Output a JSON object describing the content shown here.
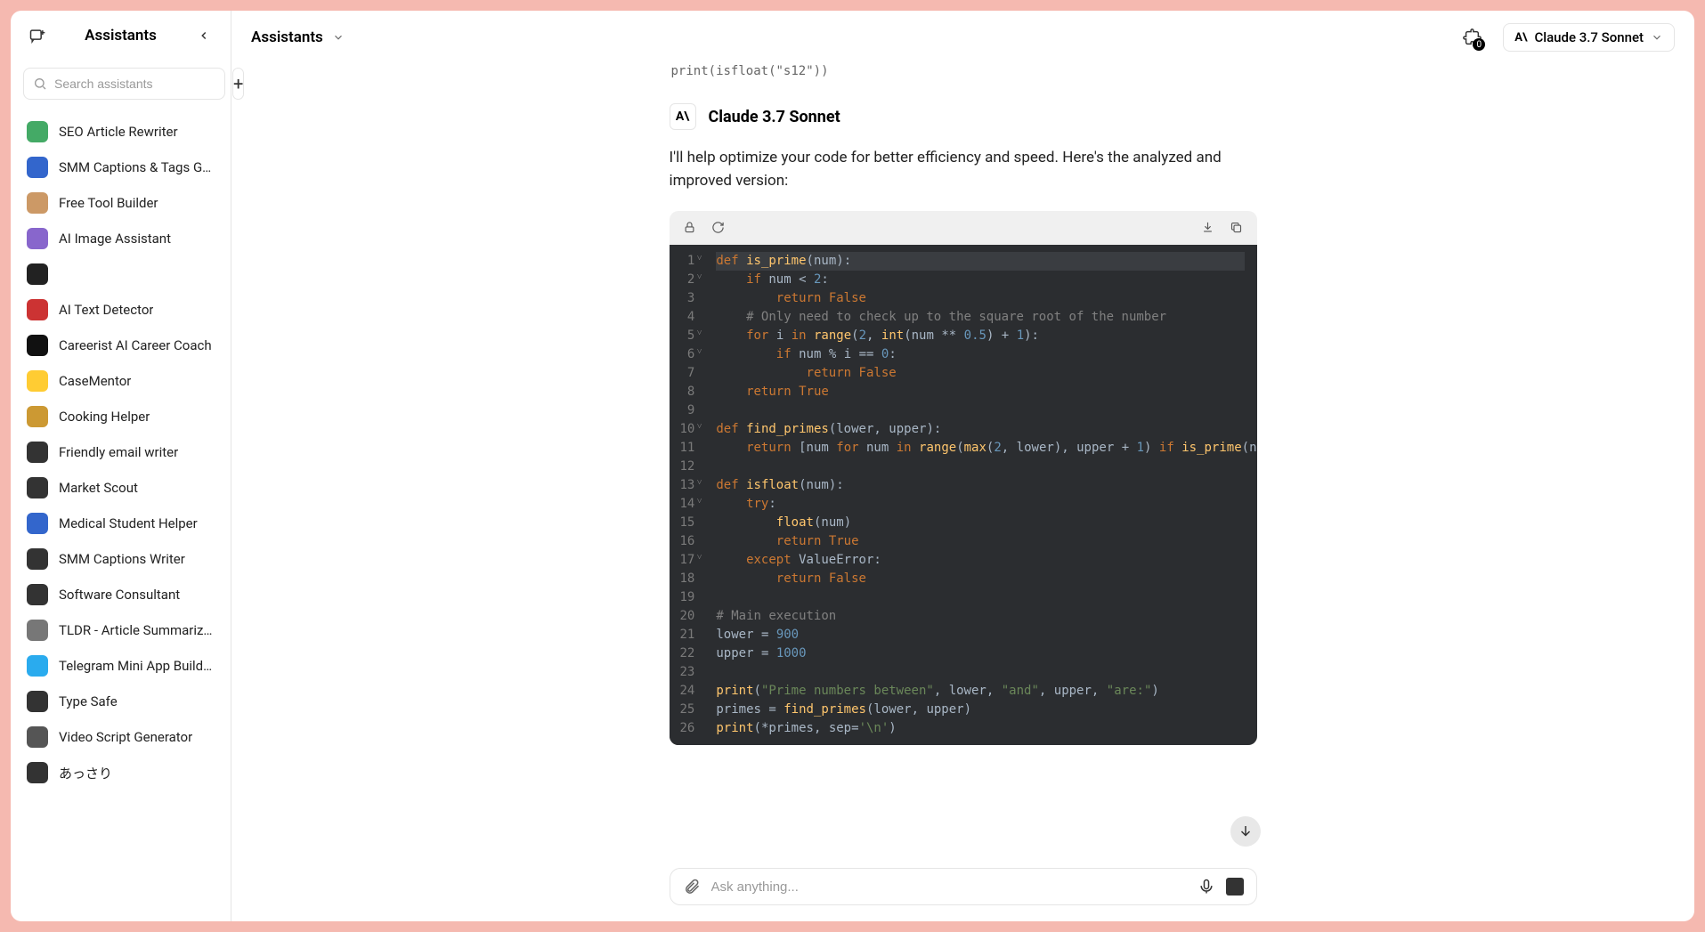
{
  "sidebar": {
    "title": "Assistants",
    "search_placeholder": "Search assistants",
    "items": [
      {
        "label": "SEO Article Rewriter",
        "color": "#4a6"
      },
      {
        "label": "SMM Captions & Tags Gen...",
        "color": "#36c"
      },
      {
        "label": "Free Tool Builder",
        "color": "#c96"
      },
      {
        "label": "AI Image Assistant",
        "color": "#86c"
      },
      {
        "label": "",
        "color": "#222"
      },
      {
        "label": "AI Text Detector",
        "color": "#c33"
      },
      {
        "label": "Careerist AI Career Coach",
        "color": "#111"
      },
      {
        "label": "CaseMentor",
        "color": "#fc3"
      },
      {
        "label": "Cooking Helper",
        "color": "#c93"
      },
      {
        "label": "Friendly email writer",
        "color": "#333"
      },
      {
        "label": "Market Scout",
        "color": "#333"
      },
      {
        "label": "Medical Student Helper",
        "color": "#36c"
      },
      {
        "label": "SMM Captions Writer",
        "color": "#333"
      },
      {
        "label": "Software Consultant",
        "color": "#333"
      },
      {
        "label": "TLDR - Article Summarizer",
        "color": "#777"
      },
      {
        "label": "Telegram Mini App Builder",
        "color": "#2aabee"
      },
      {
        "label": "Type Safe",
        "color": "#333"
      },
      {
        "label": "Video Script Generator",
        "color": "#555"
      },
      {
        "label": "あっさり",
        "color": "#333"
      }
    ]
  },
  "header": {
    "title": "Assistants",
    "badge_count": "0",
    "model": "Claude 3.7 Sonnet"
  },
  "message": {
    "cut_line": "print(isfloat(\"s12\"))",
    "name": "Claude 3.7 Sonnet",
    "text": "I'll help optimize your code for better efficiency and speed. Here's the analyzed and improved version:"
  },
  "input": {
    "placeholder": "Ask anything..."
  },
  "code": {
    "lines": 26
  }
}
